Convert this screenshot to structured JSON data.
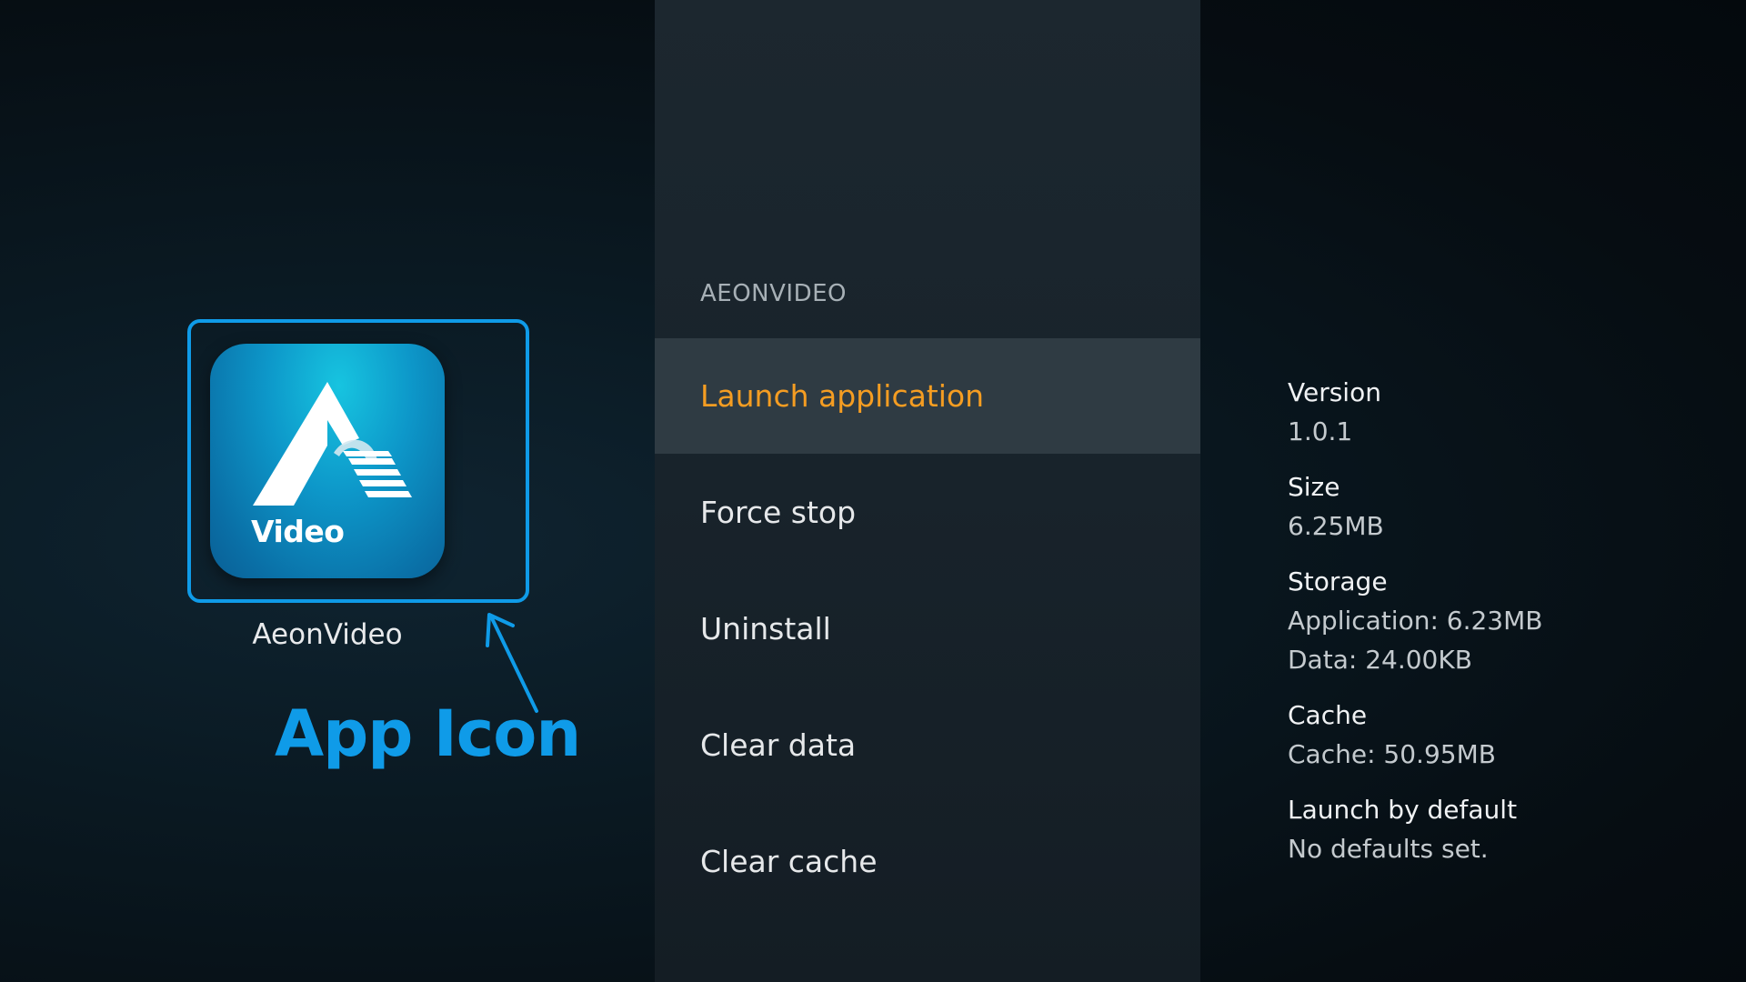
{
  "app": {
    "name": "AeonVideo",
    "icon_word": "Video",
    "icon": "aeonvideo-logo-icon"
  },
  "annotation": {
    "label": "App Icon",
    "color": "#0f9be8",
    "arrow_icon": "arrow-up-left-icon"
  },
  "menu": {
    "header": "AEONVIDEO",
    "items": [
      {
        "label": "Launch application",
        "selected": true
      },
      {
        "label": "Force stop",
        "selected": false
      },
      {
        "label": "Uninstall",
        "selected": false
      },
      {
        "label": "Clear data",
        "selected": false
      },
      {
        "label": "Clear cache",
        "selected": false
      }
    ],
    "selected_color": "#f59d22"
  },
  "info": {
    "version_label": "Version",
    "version_value": "1.0.1",
    "size_label": "Size",
    "size_value": "6.25MB",
    "storage_label": "Storage",
    "storage_application": "Application: 6.23MB",
    "storage_data": "Data: 24.00KB",
    "cache_label": "Cache",
    "cache_value": "Cache: 50.95MB",
    "launch_label": "Launch by default",
    "launch_value": "No defaults set."
  }
}
